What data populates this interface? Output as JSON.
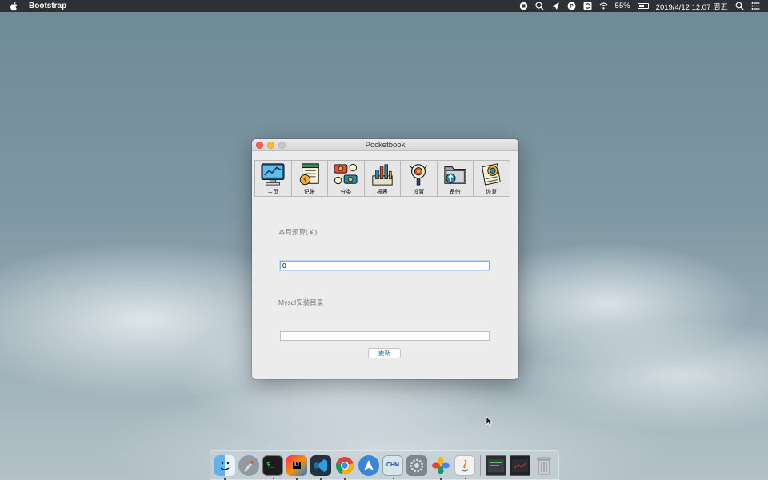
{
  "menubar": {
    "app_name": "Bootstrap",
    "battery": "55%",
    "datetime": "2019/4/12 12:07 周五",
    "status_icons": [
      "record-icon",
      "search-plus-icon",
      "send-icon",
      "p-badge-icon",
      "s-badge-icon",
      "wifi-icon"
    ]
  },
  "window": {
    "title": "Pocketbook",
    "toolbar": [
      {
        "label": "主页",
        "icon": "monitor-chart-icon"
      },
      {
        "label": "记账",
        "icon": "ledger-coin-icon"
      },
      {
        "label": "分类",
        "icon": "currency-exchange-icon"
      },
      {
        "label": "报表",
        "icon": "bar-report-icon"
      },
      {
        "label": "设置",
        "icon": "magnifier-settings-icon"
      },
      {
        "label": "备份",
        "icon": "folder-backup-icon"
      },
      {
        "label": "恢复",
        "icon": "document-restore-icon"
      }
    ],
    "budget_label": "本月预算(￥)",
    "budget_value": "0",
    "mysql_label": "Mysql安装目录",
    "mysql_value": "",
    "update_button": "更新"
  },
  "dock": {
    "apps": [
      "finder-icon",
      "launchpad-icon",
      "terminal-icon",
      "intellij-icon",
      "vscode-icon",
      "chrome-icon",
      "maps-arrow-icon",
      "chm-reader-icon",
      "system-preferences-icon",
      "photos-icon",
      "java-icon",
      "window-thumbnail-icon",
      "window-thumbnail-icon",
      "trash-icon"
    ],
    "chm_label": "CHM",
    "ij_label": "IJ"
  },
  "colors": {
    "menubar": "#2b3134",
    "accent": "#2a6fd6",
    "close": "#fc5f57",
    "minimize": "#fdbc2e"
  }
}
